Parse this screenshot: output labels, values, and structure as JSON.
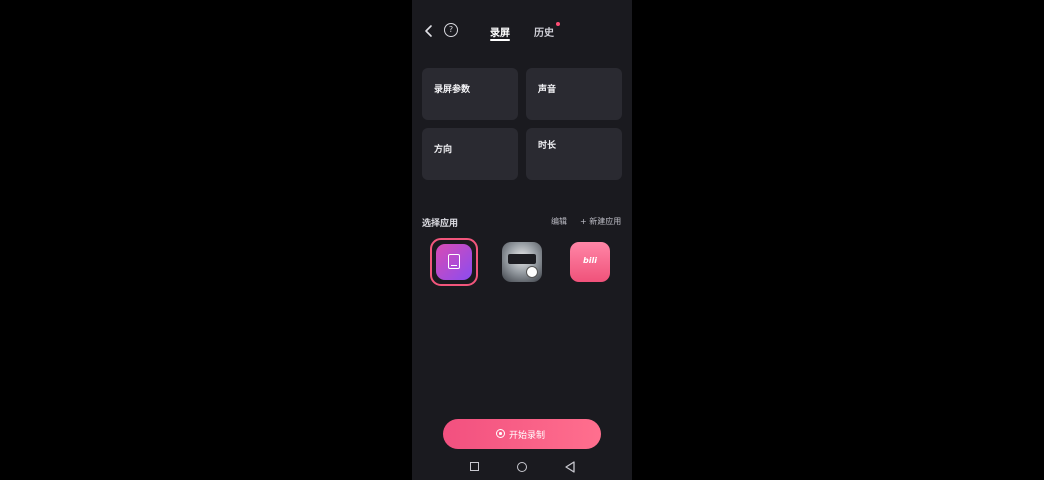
{
  "status_bar": {
    "left_text": "",
    "right_text": ""
  },
  "header": {
    "tabs": [
      {
        "label": "录屏",
        "active": true
      },
      {
        "label": "历史",
        "active": false
      }
    ]
  },
  "storage_info": "",
  "cards": [
    {
      "title": "录屏参数",
      "subtitle": ""
    },
    {
      "title": "声音",
      "subtitle": ""
    },
    {
      "title": "方向",
      "subtitle": ""
    },
    {
      "title": "时长",
      "subtitle": "",
      "subtitle2": ""
    }
  ],
  "apps_section": {
    "title": "选择应用",
    "edit_label": "编辑",
    "add_label": "+ 新建应用"
  },
  "apps": [
    {
      "label": "",
      "icon": "screen-record-icon",
      "selected": true
    },
    {
      "label": "",
      "icon": "game-icon",
      "selected": false
    },
    {
      "label": "",
      "icon": "bilibili-icon",
      "selected": false
    }
  ],
  "record_button": {
    "label": "开始录制"
  },
  "colors": {
    "background": "#1a1a1f",
    "card": "#2a2a31",
    "accent": "#f2567c",
    "warning": "#e88a3c"
  }
}
